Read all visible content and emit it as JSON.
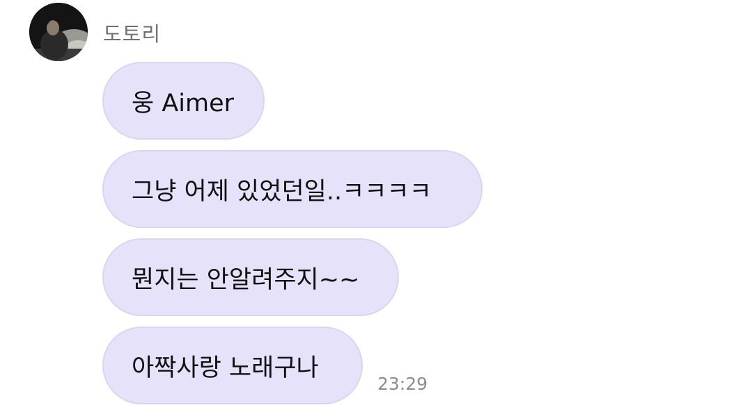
{
  "sender": {
    "name": "도토리",
    "avatar_icon": "profile-photo"
  },
  "messages": [
    {
      "text": "웅 Aimer"
    },
    {
      "text": "그냥 어제 있었던일..ㅋㅋㅋㅋ"
    },
    {
      "text": "뭔지는 안알려주지~~"
    },
    {
      "text": "아짝사랑 노래구나"
    }
  ],
  "timestamp": "23:29",
  "colors": {
    "bubble_background": "#e6e2fa",
    "bubble_border": "#dad5f1",
    "name_text": "#707070",
    "timestamp_text": "#8c8c8c",
    "message_text": "#111111"
  }
}
